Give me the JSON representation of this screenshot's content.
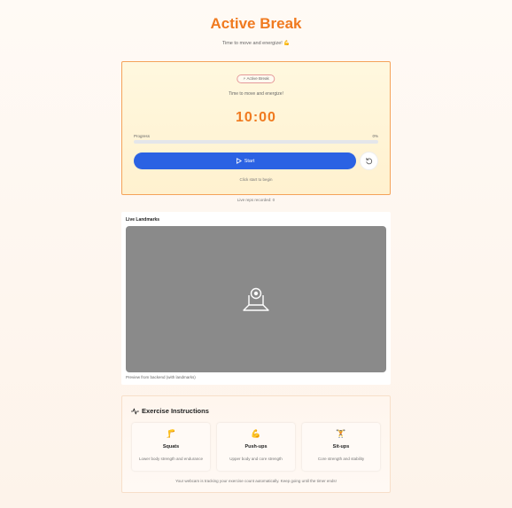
{
  "header": {
    "title": "Active Break",
    "subtitle": "Time to move and energize! 💪"
  },
  "timer_card": {
    "badge_icon": "⚡",
    "badge_label": "Active Break",
    "subtitle": "Time to move and energize!",
    "time": "10:00",
    "progress_label": "Progress",
    "progress_text": "0%",
    "progress_value": 0,
    "start_label": "Start",
    "start_icon": "play-icon",
    "reset_icon": "reset-icon",
    "hint": "Click start to begin",
    "accent": "#f07a1f",
    "button_color": "#2b62e3"
  },
  "reps_text": "Live reps recorded: 0",
  "landmarks": {
    "title": "Live Landmarks",
    "caption": "Preview from backend (with landmarks)",
    "placeholder_icon": "webcam-icon"
  },
  "instructions": {
    "title": "Exercise Instructions",
    "title_icon": "activity-icon",
    "exercises": [
      {
        "icon": "🦵",
        "name": "Squats",
        "desc": "Lower body strength and endurance"
      },
      {
        "icon": "💪",
        "name": "Push-ups",
        "desc": "Upper body and core strength"
      },
      {
        "icon": "🏋️",
        "name": "Sit-ups",
        "desc": "Core strength and stability"
      }
    ],
    "footer": "Your webcam is tracking your exercise count automatically. Keep going until the timer ends!"
  }
}
